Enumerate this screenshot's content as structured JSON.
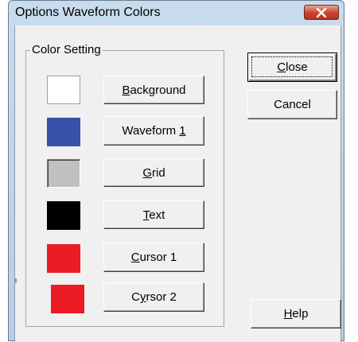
{
  "window": {
    "title": "Options Waveform Colors",
    "close_icon": "close-icon"
  },
  "group": {
    "legend": "Color Setting",
    "rows": [
      {
        "pre": "",
        "key": "B",
        "post": "ackground",
        "color": "#ffffff"
      },
      {
        "pre": "Waveform ",
        "key": "1",
        "post": "",
        "color": "#3652a6"
      },
      {
        "pre": "",
        "key": "G",
        "post": "rid",
        "color": "#c0c0c0"
      },
      {
        "pre": "",
        "key": "T",
        "post": "ext",
        "color": "#000000"
      },
      {
        "pre": "",
        "key": "C",
        "post": "ursor 1",
        "color": "#ec1c24"
      },
      {
        "pre": "C",
        "key": "y",
        "post": "rsor 2",
        "color": "#ec1c24"
      }
    ]
  },
  "buttons": {
    "close": {
      "pre": "",
      "key": "C",
      "post": "lose"
    },
    "cancel": {
      "pre": "Cancel",
      "key": "",
      "post": ""
    },
    "help": {
      "pre": "",
      "key": "H",
      "post": "elp"
    }
  }
}
